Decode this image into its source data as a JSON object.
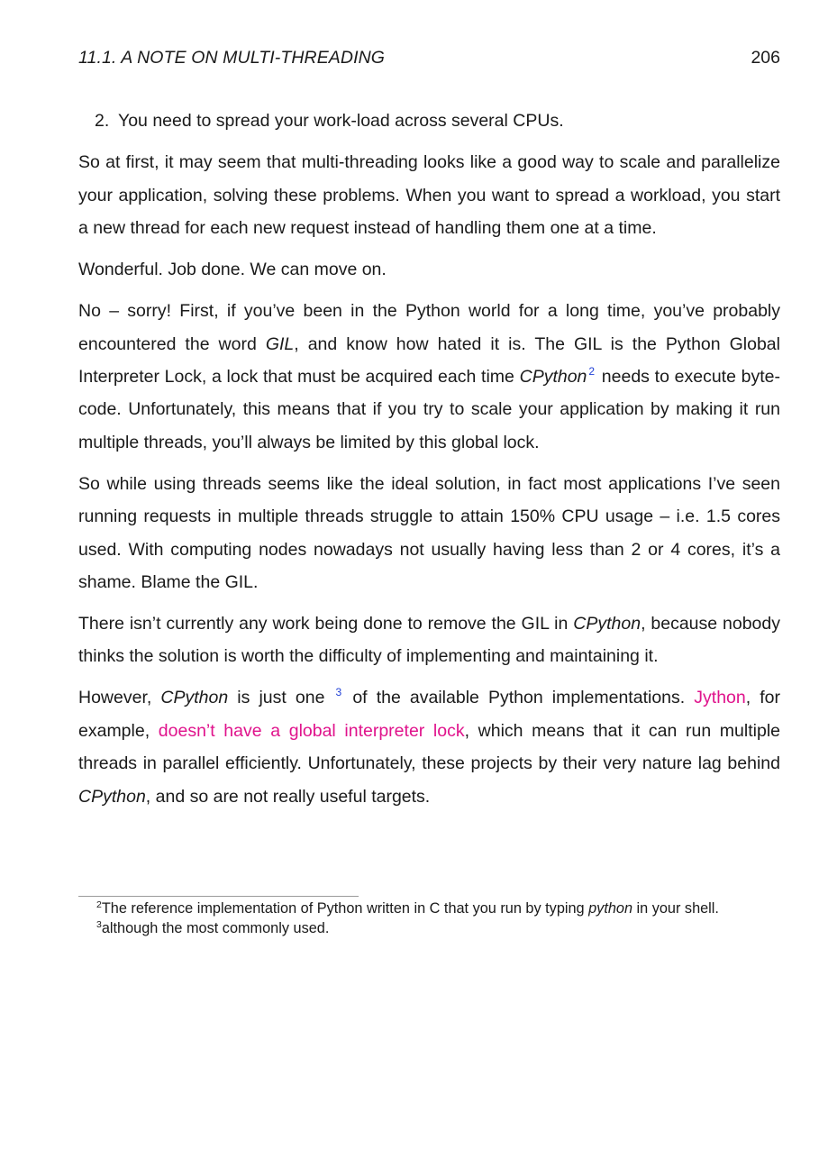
{
  "header": {
    "chapter": "11.1.  A NOTE ON MULTI-THREADING",
    "page_number": "206"
  },
  "list": {
    "number": "2.",
    "text": "You need to spread your work-load across several CPUs."
  },
  "paragraphs": {
    "p1": "So at first, it may seem that multi-threading looks like a good way to scale and parallelize your application, solving these problems. When you want to spread a workload, you start a new thread for each new request instead of handling them one at a time.",
    "p2": "Wonderful. Job done. We can move on.",
    "p3": {
      "a": "No – sorry! First, if you’ve been in the Python world for a long time, you’ve probably encountered the word ",
      "gil": "GIL",
      "b": ", and know how hated it is. The GIL is the Python Global Interpreter Lock, a lock that must be acquired each time ",
      "cpython": "CPython",
      "ref": "2",
      "c": " needs to execute byte-code. Unfortunately, this means that if you try to scale your application by making it run multiple threads, you’ll always be limited by this global lock."
    },
    "p4": "So while using threads seems like the ideal solution, in fact most applications I’ve seen running requests in multiple threads struggle to attain 150% CPU usage – i.e. 1.5 cores used. With computing nodes nowadays not usually having less than 2 or 4 cores, it’s a shame. Blame the GIL.",
    "p5": {
      "a": "There isn’t currently any work being done to remove the GIL in ",
      "cpython": "CPython",
      "b": ", because nobody thinks the solution is worth the difficulty of implementing and maintaining it."
    },
    "p6": {
      "a": "However, ",
      "cpython1": "CPython",
      "b": " is just one ",
      "ref": "3",
      "c": " of the available Python implementations. ",
      "link_jython": "Jython",
      "d": ", for example, ",
      "link_gil": "doesn’t have a global interpreter lock",
      "e": ", which means that it can run multiple threads in parallel efficiently. Unfortunately, these projects by their very nature lag behind ",
      "cpython2": "CPython",
      "f": ", and so are not really useful targets."
    }
  },
  "footnotes": {
    "fn2": {
      "mark": "2",
      "a": "The reference implementation of Python written in C that you run by typing ",
      "em": "python",
      "b": " in your shell."
    },
    "fn3": {
      "mark": "3",
      "text": "although the most commonly used."
    }
  },
  "colors": {
    "link": "#e0138c",
    "footnote_ref": "#1f3fd6"
  }
}
